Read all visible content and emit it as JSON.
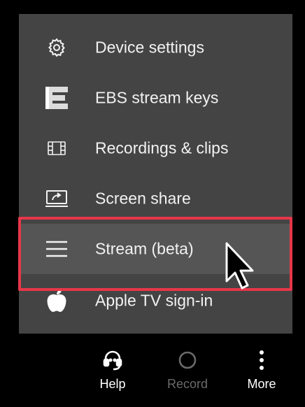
{
  "menu": {
    "items": [
      {
        "label": "Device settings",
        "icon": "gear-icon"
      },
      {
        "label": "EBS stream keys",
        "icon": "ebs-logo-icon"
      },
      {
        "label": "Recordings & clips",
        "icon": "film-strip-icon"
      },
      {
        "label": "Screen share",
        "icon": "screen-share-icon"
      },
      {
        "label": "Stream (beta)",
        "icon": "hamburger-lines-icon"
      },
      {
        "label": "Apple TV sign-in",
        "icon": "apple-logo-icon"
      }
    ]
  },
  "bottom_bar": {
    "help": {
      "label": "Help",
      "icon": "headset-icon"
    },
    "record": {
      "label": "Record",
      "icon": "record-circle-icon"
    },
    "more": {
      "label": "More",
      "icon": "vertical-dots-icon"
    }
  },
  "colors": {
    "menu_bg": "#444444",
    "selected_bg": "#555555",
    "highlight_border": "#e8364a",
    "text": "#f2f2f2",
    "disabled_text": "#6a6a6a",
    "page_bg": "#000000"
  }
}
